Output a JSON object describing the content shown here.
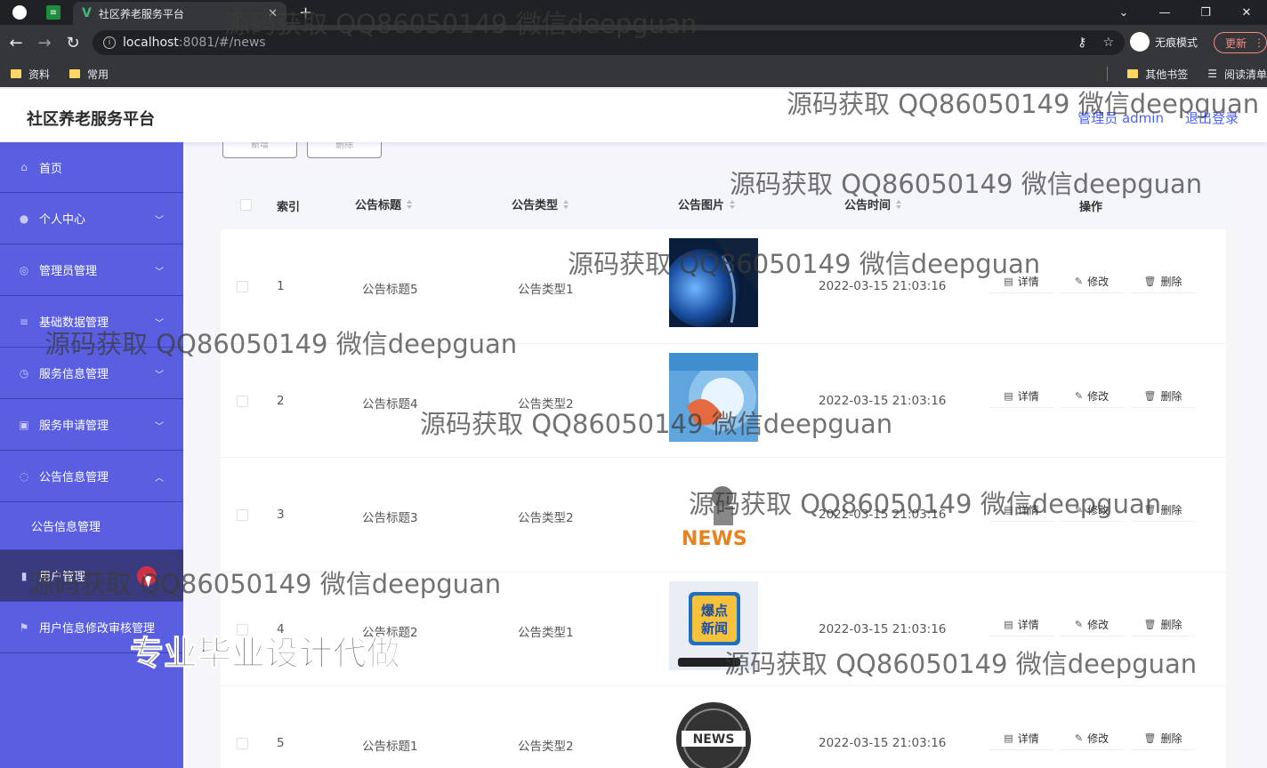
{
  "browser": {
    "tab_title": "社区养老服务平台",
    "url_host": "localhost",
    "url_rest": ":8081/#/news",
    "incognito_label": "无痕模式",
    "update_label": "更新",
    "bookmarks": [
      "资料",
      "常用"
    ],
    "bookmarks_right": [
      "其他书签",
      "阅读清单"
    ]
  },
  "header": {
    "brand": "社区养老服务平台",
    "admin_label": "管理员 admin",
    "logout_label": "退出登录"
  },
  "sidebar": {
    "items": [
      {
        "label": "首页",
        "icon": "home-icon",
        "chevron": ""
      },
      {
        "label": "个人中心",
        "icon": "user-icon",
        "chevron": "⌄"
      },
      {
        "label": "管理员管理",
        "icon": "admin-icon",
        "chevron": "⌄"
      },
      {
        "label": "基础数据管理",
        "icon": "list-icon",
        "chevron": "⌄"
      },
      {
        "label": "服务信息管理",
        "icon": "service-icon",
        "chevron": "⌄"
      },
      {
        "label": "服务申请管理",
        "icon": "apply-icon",
        "chevron": "⌄"
      },
      {
        "label": "公告信息管理",
        "icon": "notice-icon",
        "chevron": "⌃"
      }
    ],
    "submenu_label": "公告信息管理",
    "items_after": [
      {
        "label": "用户管理",
        "icon": "users-icon",
        "chevron": "⌄"
      },
      {
        "label": "用户信息修改审核管理",
        "icon": "flag-icon",
        "chevron": ""
      }
    ]
  },
  "toolbar": {
    "add_label": "新增",
    "delete_label": "删除"
  },
  "table": {
    "headers": {
      "index": "索引",
      "title": "公告标题",
      "type": "公告类型",
      "image": "公告图片",
      "time": "公告时间",
      "ops": "操作"
    },
    "rows": [
      {
        "index": "1",
        "title": "公告标题5",
        "type": "公告类型1",
        "time": "2022-03-15 21:03:16",
        "image": "globe-tech"
      },
      {
        "index": "2",
        "title": "公告标题4",
        "type": "公告类型2",
        "time": "2022-03-15 21:03:16",
        "image": "news-blue"
      },
      {
        "index": "3",
        "title": "公告标题3",
        "type": "公告类型2",
        "time": "2022-03-15 21:03:16",
        "image": "news-3d"
      },
      {
        "index": "4",
        "title": "公告标题2",
        "type": "公告类型1",
        "time": "2022-03-15 21:03:16",
        "image": "baodian-xinwen"
      },
      {
        "index": "5",
        "title": "公告标题1",
        "type": "公告类型2",
        "time": "2022-03-15 21:03:16",
        "image": "news-globe"
      }
    ],
    "ops": {
      "detail": "详情",
      "edit": "修改",
      "delete": "删除"
    }
  },
  "watermarks": {
    "text": "源码获取 QQ86050149 微信deepguan",
    "big": "专业毕业设计代做"
  },
  "thumb_texts": {
    "news3": "NEWS",
    "bd1": "爆点",
    "bd2": "新闻",
    "news5": "NEWS"
  }
}
